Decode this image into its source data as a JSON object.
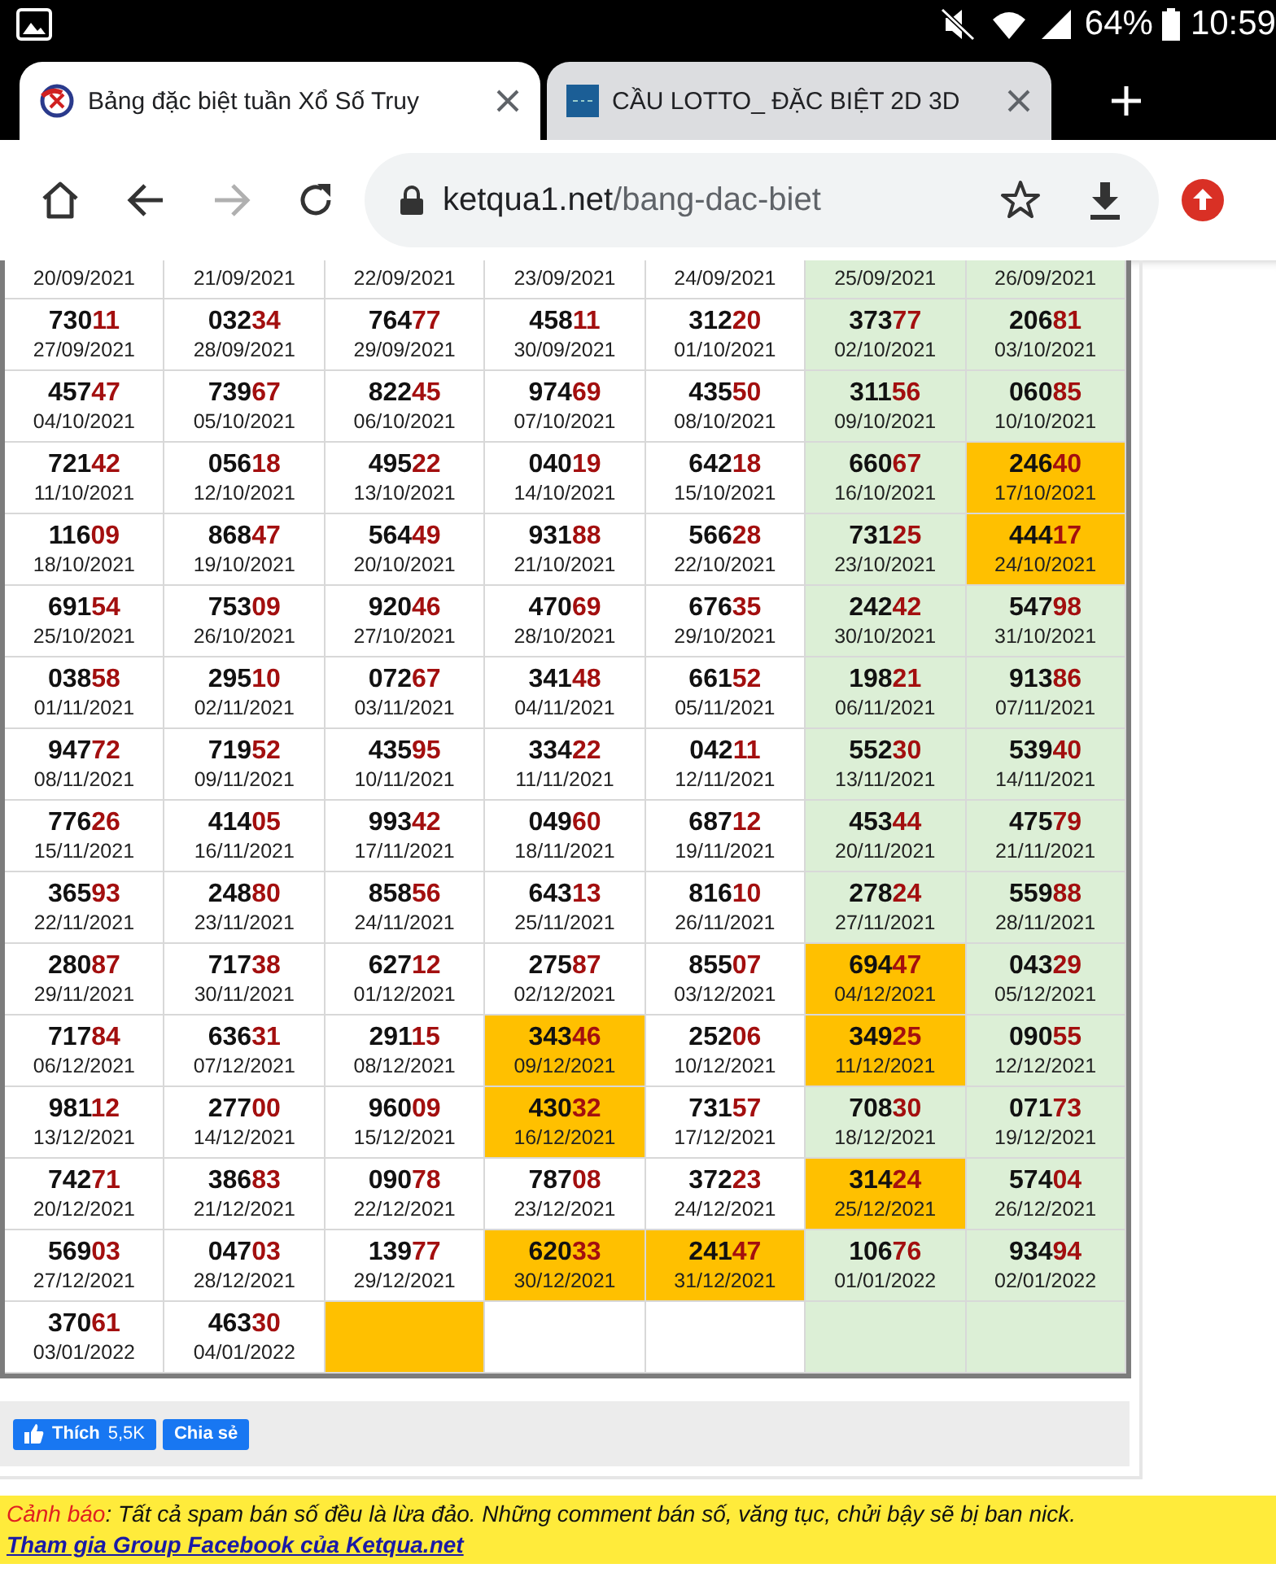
{
  "status_bar": {
    "battery": "64%",
    "time": "10:59"
  },
  "tabs": [
    {
      "title": "Bảng đặc biệt tuần Xổ Số Truy",
      "selected": true
    },
    {
      "title": "CẦU LOTTO_ ĐẶC BIỆT 2D 3D",
      "selected": false
    }
  ],
  "toolbar": {
    "forward_disabled": true,
    "domain": "ketqua1.net",
    "path": "/bang-dac-biet"
  },
  "table": {
    "rows": [
      [
        {
          "date": "20/09/2021",
          "highlighted": false,
          "weekend": false
        },
        {
          "date": "21/09/2021",
          "highlighted": false,
          "weekend": false
        },
        {
          "date": "22/09/2021",
          "highlighted": false,
          "weekend": false
        },
        {
          "date": "23/09/2021",
          "highlighted": false,
          "weekend": false
        },
        {
          "date": "24/09/2021",
          "highlighted": false,
          "weekend": false
        },
        {
          "date": "25/09/2021",
          "highlighted": false,
          "weekend": true
        },
        {
          "date": "26/09/2021",
          "highlighted": false,
          "weekend": true
        }
      ],
      [
        {
          "number": "73011",
          "date": "27/09/2021",
          "highlighted": false,
          "weekend": false
        },
        {
          "number": "03234",
          "date": "28/09/2021",
          "highlighted": false,
          "weekend": false
        },
        {
          "number": "76477",
          "date": "29/09/2021",
          "highlighted": false,
          "weekend": false
        },
        {
          "number": "45811",
          "date": "30/09/2021",
          "highlighted": false,
          "weekend": false
        },
        {
          "number": "31220",
          "date": "01/10/2021",
          "highlighted": false,
          "weekend": false
        },
        {
          "number": "37377",
          "date": "02/10/2021",
          "highlighted": false,
          "weekend": true
        },
        {
          "number": "20681",
          "date": "03/10/2021",
          "highlighted": false,
          "weekend": true
        }
      ],
      [
        {
          "number": "45747",
          "date": "04/10/2021",
          "highlighted": false,
          "weekend": false
        },
        {
          "number": "73967",
          "date": "05/10/2021",
          "highlighted": false,
          "weekend": false
        },
        {
          "number": "82245",
          "date": "06/10/2021",
          "highlighted": false,
          "weekend": false
        },
        {
          "number": "97469",
          "date": "07/10/2021",
          "highlighted": false,
          "weekend": false
        },
        {
          "number": "43550",
          "date": "08/10/2021",
          "highlighted": false,
          "weekend": false
        },
        {
          "number": "31156",
          "date": "09/10/2021",
          "highlighted": false,
          "weekend": true
        },
        {
          "number": "06085",
          "date": "10/10/2021",
          "highlighted": false,
          "weekend": true
        }
      ],
      [
        {
          "number": "72142",
          "date": "11/10/2021",
          "highlighted": false,
          "weekend": false
        },
        {
          "number": "05618",
          "date": "12/10/2021",
          "highlighted": false,
          "weekend": false
        },
        {
          "number": "49522",
          "date": "13/10/2021",
          "highlighted": false,
          "weekend": false
        },
        {
          "number": "04019",
          "date": "14/10/2021",
          "highlighted": false,
          "weekend": false
        },
        {
          "number": "64218",
          "date": "15/10/2021",
          "highlighted": false,
          "weekend": false
        },
        {
          "number": "66067",
          "date": "16/10/2021",
          "highlighted": false,
          "weekend": true
        },
        {
          "number": "24640",
          "date": "17/10/2021",
          "highlighted": true
        }
      ],
      [
        {
          "number": "11609",
          "date": "18/10/2021",
          "highlighted": false,
          "weekend": false
        },
        {
          "number": "86847",
          "date": "19/10/2021",
          "highlighted": false,
          "weekend": false
        },
        {
          "number": "56449",
          "date": "20/10/2021",
          "highlighted": false,
          "weekend": false
        },
        {
          "number": "93188",
          "date": "21/10/2021",
          "highlighted": false,
          "weekend": false
        },
        {
          "number": "56628",
          "date": "22/10/2021",
          "highlighted": false,
          "weekend": false
        },
        {
          "number": "73125",
          "date": "23/10/2021",
          "highlighted": false,
          "weekend": true
        },
        {
          "number": "44417",
          "date": "24/10/2021",
          "highlighted": true
        }
      ],
      [
        {
          "number": "69154",
          "date": "25/10/2021",
          "highlighted": false,
          "weekend": false
        },
        {
          "number": "75309",
          "date": "26/10/2021",
          "highlighted": false,
          "weekend": false
        },
        {
          "number": "92046",
          "date": "27/10/2021",
          "highlighted": false,
          "weekend": false
        },
        {
          "number": "47069",
          "date": "28/10/2021",
          "highlighted": false,
          "weekend": false
        },
        {
          "number": "67635",
          "date": "29/10/2021",
          "highlighted": false,
          "weekend": false
        },
        {
          "number": "24242",
          "date": "30/10/2021",
          "highlighted": false,
          "weekend": true
        },
        {
          "number": "54798",
          "date": "31/10/2021",
          "highlighted": false,
          "weekend": true
        }
      ],
      [
        {
          "number": "03858",
          "date": "01/11/2021",
          "highlighted": false,
          "weekend": false
        },
        {
          "number": "29510",
          "date": "02/11/2021",
          "highlighted": false,
          "weekend": false
        },
        {
          "number": "07267",
          "date": "03/11/2021",
          "highlighted": false,
          "weekend": false
        },
        {
          "number": "34148",
          "date": "04/11/2021",
          "highlighted": false,
          "weekend": false
        },
        {
          "number": "66152",
          "date": "05/11/2021",
          "highlighted": false,
          "weekend": false
        },
        {
          "number": "19821",
          "date": "06/11/2021",
          "highlighted": false,
          "weekend": true
        },
        {
          "number": "91386",
          "date": "07/11/2021",
          "highlighted": false,
          "weekend": true
        }
      ],
      [
        {
          "number": "94772",
          "date": "08/11/2021",
          "highlighted": false,
          "weekend": false
        },
        {
          "number": "71952",
          "date": "09/11/2021",
          "highlighted": false,
          "weekend": false
        },
        {
          "number": "43595",
          "date": "10/11/2021",
          "highlighted": false,
          "weekend": false
        },
        {
          "number": "33422",
          "date": "11/11/2021",
          "highlighted": false,
          "weekend": false
        },
        {
          "number": "04211",
          "date": "12/11/2021",
          "highlighted": false,
          "weekend": false
        },
        {
          "number": "55230",
          "date": "13/11/2021",
          "highlighted": false,
          "weekend": true
        },
        {
          "number": "53940",
          "date": "14/11/2021",
          "highlighted": false,
          "weekend": true
        }
      ],
      [
        {
          "number": "77626",
          "date": "15/11/2021",
          "highlighted": false,
          "weekend": false
        },
        {
          "number": "41405",
          "date": "16/11/2021",
          "highlighted": false,
          "weekend": false
        },
        {
          "number": "99342",
          "date": "17/11/2021",
          "highlighted": false,
          "weekend": false
        },
        {
          "number": "04960",
          "date": "18/11/2021",
          "highlighted": false,
          "weekend": false
        },
        {
          "number": "68712",
          "date": "19/11/2021",
          "highlighted": false,
          "weekend": false
        },
        {
          "number": "45344",
          "date": "20/11/2021",
          "highlighted": false,
          "weekend": true
        },
        {
          "number": "47579",
          "date": "21/11/2021",
          "highlighted": false,
          "weekend": true
        }
      ],
      [
        {
          "number": "36593",
          "date": "22/11/2021",
          "highlighted": false,
          "weekend": false
        },
        {
          "number": "24880",
          "date": "23/11/2021",
          "highlighted": false,
          "weekend": false
        },
        {
          "number": "85856",
          "date": "24/11/2021",
          "highlighted": false,
          "weekend": false
        },
        {
          "number": "64313",
          "date": "25/11/2021",
          "highlighted": false,
          "weekend": false
        },
        {
          "number": "81610",
          "date": "26/11/2021",
          "highlighted": false,
          "weekend": false
        },
        {
          "number": "27824",
          "date": "27/11/2021",
          "highlighted": false,
          "weekend": true
        },
        {
          "number": "55988",
          "date": "28/11/2021",
          "highlighted": false,
          "weekend": true
        }
      ],
      [
        {
          "number": "28087",
          "date": "29/11/2021",
          "highlighted": false,
          "weekend": false
        },
        {
          "number": "71738",
          "date": "30/11/2021",
          "highlighted": false,
          "weekend": false
        },
        {
          "number": "62712",
          "date": "01/12/2021",
          "highlighted": false,
          "weekend": false
        },
        {
          "number": "27587",
          "date": "02/12/2021",
          "highlighted": false,
          "weekend": false
        },
        {
          "number": "85507",
          "date": "03/12/2021",
          "highlighted": false,
          "weekend": false
        },
        {
          "number": "69447",
          "date": "04/12/2021",
          "highlighted": true
        },
        {
          "number": "04329",
          "date": "05/12/2021",
          "highlighted": false,
          "weekend": true
        }
      ],
      [
        {
          "number": "71784",
          "date": "06/12/2021",
          "highlighted": false,
          "weekend": false
        },
        {
          "number": "63631",
          "date": "07/12/2021",
          "highlighted": false,
          "weekend": false
        },
        {
          "number": "29115",
          "date": "08/12/2021",
          "highlighted": false,
          "weekend": false
        },
        {
          "number": "34346",
          "date": "09/12/2021",
          "highlighted": true
        },
        {
          "number": "25206",
          "date": "10/12/2021",
          "highlighted": false,
          "weekend": false
        },
        {
          "number": "34925",
          "date": "11/12/2021",
          "highlighted": true
        },
        {
          "number": "09055",
          "date": "12/12/2021",
          "highlighted": false,
          "weekend": true
        }
      ],
      [
        {
          "number": "98112",
          "date": "13/12/2021",
          "highlighted": false,
          "weekend": false
        },
        {
          "number": "27700",
          "date": "14/12/2021",
          "highlighted": false,
          "weekend": false
        },
        {
          "number": "96009",
          "date": "15/12/2021",
          "highlighted": false,
          "weekend": false
        },
        {
          "number": "43032",
          "date": "16/12/2021",
          "highlighted": true
        },
        {
          "number": "73157",
          "date": "17/12/2021",
          "highlighted": false,
          "weekend": false
        },
        {
          "number": "70830",
          "date": "18/12/2021",
          "highlighted": false,
          "weekend": true
        },
        {
          "number": "07173",
          "date": "19/12/2021",
          "highlighted": false,
          "weekend": true
        }
      ],
      [
        {
          "number": "74271",
          "date": "20/12/2021",
          "highlighted": false,
          "weekend": false
        },
        {
          "number": "38683",
          "date": "21/12/2021",
          "highlighted": false,
          "weekend": false
        },
        {
          "number": "09078",
          "date": "22/12/2021",
          "highlighted": false,
          "weekend": false
        },
        {
          "number": "78708",
          "date": "23/12/2021",
          "highlighted": false,
          "weekend": false
        },
        {
          "number": "37223",
          "date": "24/12/2021",
          "highlighted": false,
          "weekend": false
        },
        {
          "number": "31424",
          "date": "25/12/2021",
          "highlighted": true
        },
        {
          "number": "57404",
          "date": "26/12/2021",
          "highlighted": false,
          "weekend": true
        }
      ],
      [
        {
          "number": "56903",
          "date": "27/12/2021",
          "highlighted": false,
          "weekend": false
        },
        {
          "number": "04703",
          "date": "28/12/2021",
          "highlighted": false,
          "weekend": false
        },
        {
          "number": "13977",
          "date": "29/12/2021",
          "highlighted": false,
          "weekend": false
        },
        {
          "number": "62033",
          "date": "30/12/2021",
          "highlighted": true
        },
        {
          "number": "24147",
          "date": "31/12/2021",
          "highlighted": true
        },
        {
          "number": "10676",
          "date": "01/01/2022",
          "highlighted": false,
          "weekend": true
        },
        {
          "number": "93494",
          "date": "02/01/2022",
          "highlighted": false,
          "weekend": true
        }
      ],
      [
        {
          "number": "37061",
          "date": "03/01/2022",
          "highlighted": false,
          "weekend": false
        },
        {
          "number": "46330",
          "date": "04/01/2022",
          "highlighted": false,
          "weekend": false
        },
        {
          "highlighted": true
        },
        {
          "highlighted": false,
          "weekend": false
        },
        {
          "highlighted": false,
          "weekend": false
        },
        {
          "highlighted": false,
          "weekend": true
        },
        {
          "highlighted": false,
          "weekend": true
        }
      ]
    ]
  },
  "social": {
    "like_label": "Thích",
    "like_count": "5,5K",
    "share_label": "Chia sẻ"
  },
  "warning": {
    "label": "Cảnh báo",
    "text": ": Tất cả spam bán số đều là lừa đảo. Những comment bán số, văng tục, chửi bậy sẽ bị ban nick.",
    "link": "Tham gia Group Facebook của Ketqua.net"
  }
}
